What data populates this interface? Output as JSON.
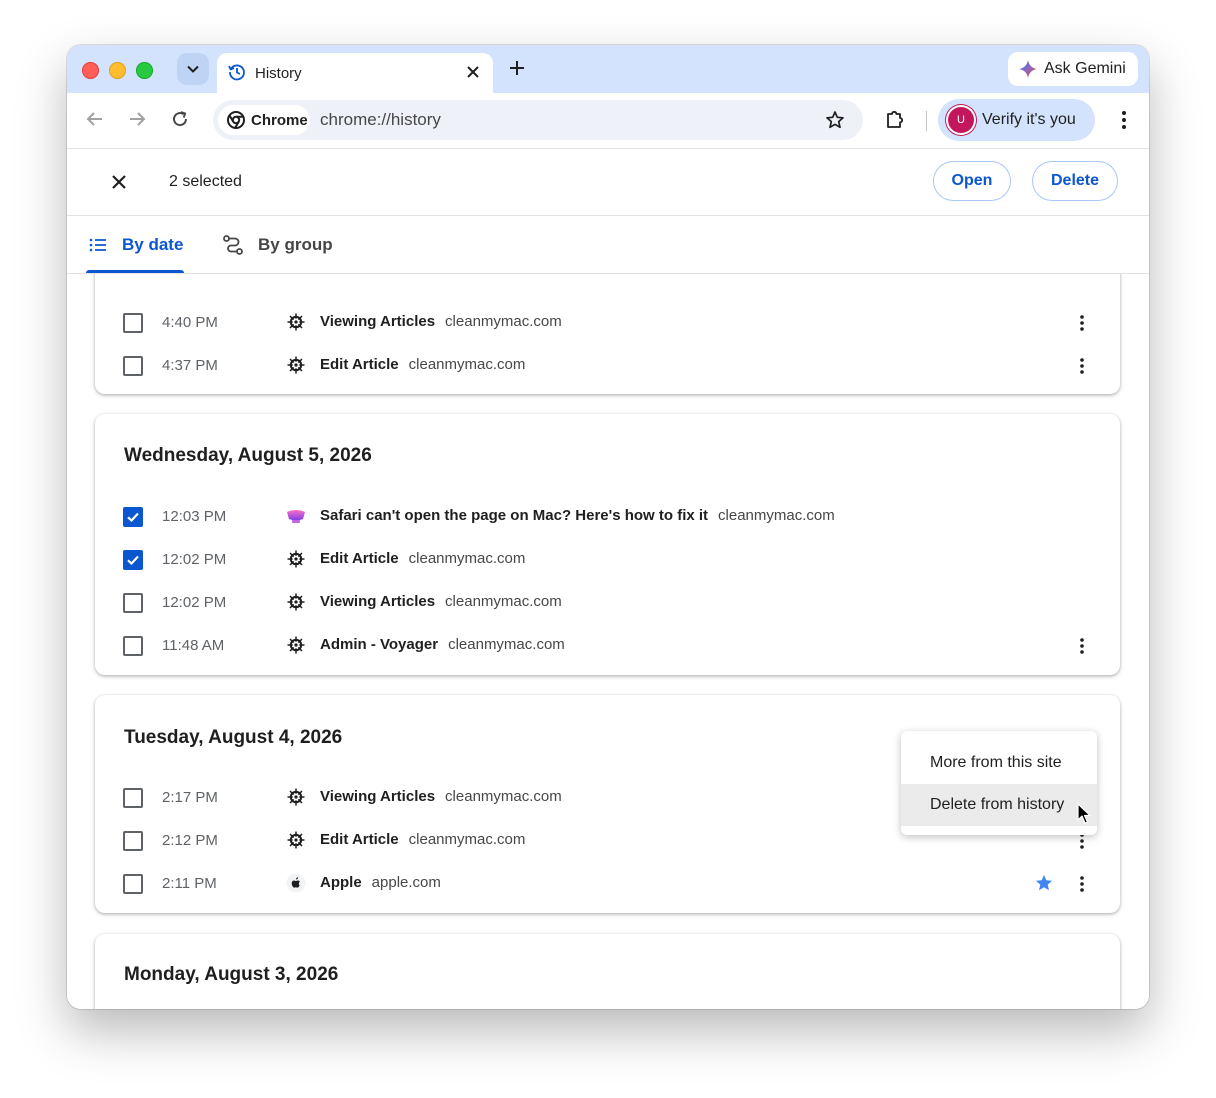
{
  "browser": {
    "tab_title": "History",
    "gemini_label": "Ask Gemini",
    "omnibox_chip": "Chrome",
    "url": "chrome://history",
    "verify_label": "Verify it's you",
    "avatar_letter": "U"
  },
  "selection": {
    "count_label": "2 selected",
    "open_label": "Open",
    "delete_label": "Delete"
  },
  "view_tabs": {
    "by_date": "By date",
    "by_group": "By group"
  },
  "groups": [
    {
      "date": "",
      "items": [
        {
          "time": "4:40 PM",
          "title": "Viewing Articles",
          "domain": "cleanmymac.com",
          "checked": false,
          "favicon": "wheel-icon"
        },
        {
          "time": "4:37 PM",
          "title": "Edit Article",
          "domain": "cleanmymac.com",
          "checked": false,
          "favicon": "wheel-icon"
        }
      ]
    },
    {
      "date": "Wednesday, August 5, 2026",
      "items": [
        {
          "time": "12:03 PM",
          "title": "Safari can't open the page on Mac? Here's how to fix it",
          "domain": "cleanmymac.com",
          "checked": true,
          "favicon": "cleanmymac-icon"
        },
        {
          "time": "12:02 PM",
          "title": "Edit Article",
          "domain": "cleanmymac.com",
          "checked": true,
          "favicon": "wheel-icon"
        },
        {
          "time": "12:02 PM",
          "title": "Viewing Articles",
          "domain": "cleanmymac.com",
          "checked": false,
          "favicon": "wheel-icon"
        },
        {
          "time": "11:48 AM",
          "title": "Admin - Voyager",
          "domain": "cleanmymac.com",
          "checked": false,
          "favicon": "wheel-icon"
        }
      ]
    },
    {
      "date": "Tuesday, August 4, 2026",
      "items": [
        {
          "time": "2:17 PM",
          "title": "Viewing Articles",
          "domain": "cleanmymac.com",
          "checked": false,
          "favicon": "wheel-icon"
        },
        {
          "time": "2:12 PM",
          "title": "Edit Article",
          "domain": "cleanmymac.com",
          "checked": false,
          "favicon": "wheel-icon"
        },
        {
          "time": "2:11 PM",
          "title": "Apple",
          "domain": "apple.com",
          "checked": false,
          "favicon": "apple-icon",
          "bookmarked": true
        }
      ]
    },
    {
      "date": "Monday, August 3, 2026",
      "items": []
    }
  ],
  "context_menu": {
    "items": [
      "More from this site",
      "Delete from history"
    ],
    "highlighted": "Delete from history"
  },
  "colors": {
    "accent": "#0b57d0",
    "tabstrip": "#d3e3fd",
    "bookmark_star": "#4285f4"
  }
}
